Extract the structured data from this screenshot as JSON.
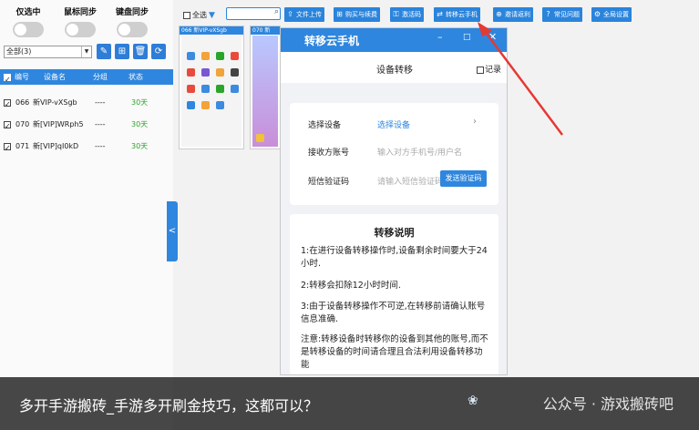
{
  "left_panel": {
    "toggles": [
      {
        "label": "仅选中"
      },
      {
        "label": "鼠标同步"
      },
      {
        "label": "键盘同步"
      }
    ],
    "group_select": "全部(3)",
    "header": {
      "num": "编号",
      "name": "设备名",
      "group": "分组",
      "status": "状态"
    },
    "devices": [
      {
        "num": "066",
        "name": "新VIP-vXSgb",
        "group": "----",
        "status": "30天"
      },
      {
        "num": "070",
        "name": "新[VIP]WRph5",
        "group": "----",
        "status": "30天"
      },
      {
        "num": "071",
        "name": "新[VIP]qI0kD",
        "group": "----",
        "status": "30天"
      }
    ],
    "collapse_glyph": "<"
  },
  "center": {
    "select_all": "全选",
    "phones": [
      {
        "label": "066  新VIP-vXSgb"
      },
      {
        "label": "070  新"
      }
    ]
  },
  "toolbar": [
    {
      "label": "文件上传",
      "icon": "upload-icon"
    },
    {
      "label": "购买与续费",
      "icon": "grid-icon"
    },
    {
      "label": "激活码",
      "icon": "key-icon"
    },
    {
      "label": "转移云手机",
      "icon": "transfer-icon"
    },
    {
      "label": "邀请返利",
      "icon": "invite-icon"
    },
    {
      "label": "常见问题",
      "icon": "question-icon"
    },
    {
      "label": "全局设置",
      "icon": "gear-icon"
    }
  ],
  "dialog": {
    "title": "转移云手机",
    "subtitle": "设备转移",
    "record": "记录",
    "form": {
      "device_label": "选择设备",
      "device_value": "选择设备",
      "account_label": "接收方账号",
      "account_placeholder": "输入对方手机号/用户名",
      "code_label": "短信验证码",
      "code_placeholder": "请输入短信验证码",
      "send_code": "发送验证码"
    },
    "explain": {
      "title": "转移说明",
      "p1": "1:在进行设备转移操作时,设备剩余时间要大于24小时.",
      "p2": "2:转移会扣除12小时时间.",
      "p3": "3:由于设备转移操作不可逆,在转移前请确认账号信息准确.",
      "note": "注意:转移设备时转移你的设备到其他的账号,而不是转移设备的时间请合理且合法利用设备转移功能"
    }
  },
  "caption": {
    "text": "多开手游搬砖_手游多开刷金技巧，这都可以？",
    "watermark": "公众号 · 游戏搬砖吧"
  },
  "colors": {
    "accent": "#2e86de",
    "status_green": "#2aa52a",
    "arrow_red": "#e53935"
  }
}
